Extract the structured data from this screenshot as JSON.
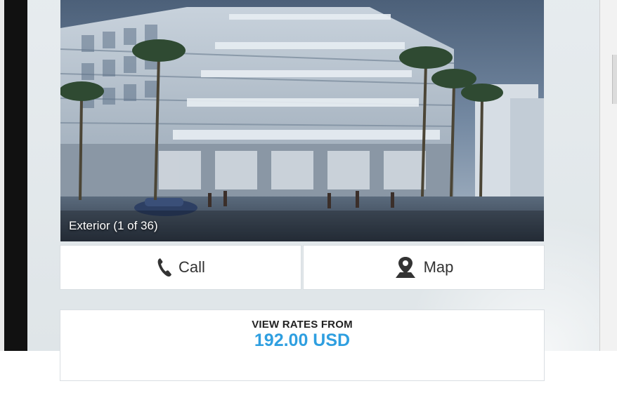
{
  "photo": {
    "caption": "Exterior (1 of 36)"
  },
  "actions": {
    "call_label": "Call",
    "map_label": "Map"
  },
  "rates": {
    "label": "VIEW RATES FROM",
    "price": "192.00 USD",
    "price_color": "#2f9fe0"
  },
  "icons": {
    "call": "phone-icon",
    "map": "map-pin-icon"
  }
}
